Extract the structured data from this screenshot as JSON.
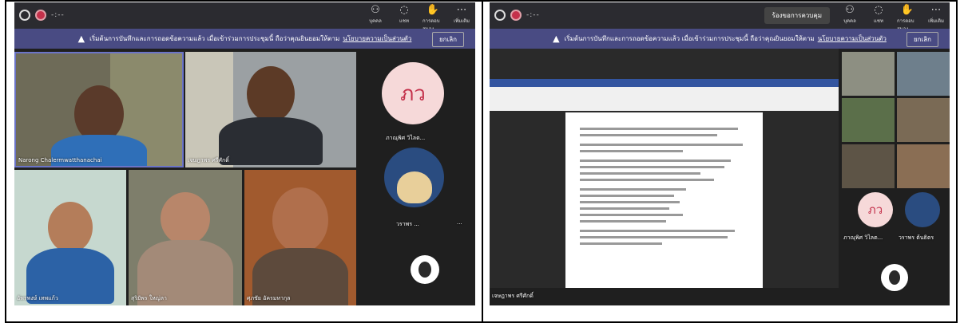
{
  "left": {
    "indicator": "-:--",
    "toolbar": [
      {
        "icon": "people-icon",
        "label": "บุคคล"
      },
      {
        "icon": "chat-icon",
        "label": "แชท"
      },
      {
        "icon": "raise-hand-icon",
        "label": "การตอบสนอง"
      },
      {
        "icon": "more-icon",
        "label": "เพิ่มเติม"
      }
    ],
    "banner": {
      "text": "เริ่มต้นการบันทึกและการถอดข้อความแล้ว  เมื่อเข้าร่วมการประชุมนี้ ถือว่าคุณยินยอมให้ตาม",
      "link": "นโยบายความเป็นส่วนตัว",
      "dismiss": "ยกเลิก"
    },
    "tiles": [
      {
        "name": "Narong Chalermwatthanachai"
      },
      {
        "name": "เจษฎาพร ศรีศักดิ์"
      },
      {
        "name": "อัพรพงษ์ เทพแก้ว"
      },
      {
        "name": "สุริยัพร ใหญ่ลา"
      },
      {
        "name": "ศุภชัย อัครมหากุล"
      }
    ],
    "side": {
      "initials": "ภว",
      "initials_name": "ภาณุพิศ วิไลต...",
      "vrp_name": "วราพร ...",
      "more": "..."
    }
  },
  "right": {
    "indicator": "-:--",
    "request_button": "ร้องขอการควบคุม",
    "toolbar": [
      {
        "icon": "people-icon",
        "label": "บุคคล"
      },
      {
        "icon": "chat-icon",
        "label": "แชท"
      },
      {
        "icon": "raise-hand-icon",
        "label": "การตอบสนอง"
      },
      {
        "icon": "more-icon",
        "label": "เพิ่มเติม"
      }
    ],
    "banner": {
      "text": "เริ่มต้นการบันทึกและการถอดข้อความแล้ว  เมื่อเข้าร่วมการประชุมนี้ ถือว่าคุณยินยอมให้ตาม",
      "link": "นโยบายความเป็นส่วนตัว",
      "dismiss": "ยกเลิก"
    },
    "presenter_name": "เจษฎาพร ศรีศักดิ์",
    "side": {
      "initials": "ภว",
      "initials_name": "ภาณุพิศ วิไลต...",
      "vrp_name": "วราพร ต้นธิตร"
    }
  }
}
